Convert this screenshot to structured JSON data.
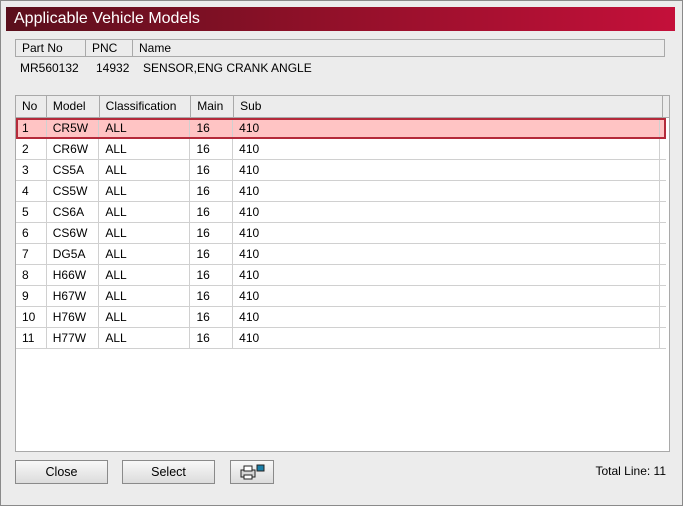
{
  "window": {
    "title": "Applicable Vehicle Models"
  },
  "part": {
    "headers": [
      "Part No",
      "PNC",
      "Name"
    ],
    "part_no": "MR560132",
    "pnc": "14932",
    "name": "SENSOR,ENG CRANK ANGLE"
  },
  "list": {
    "headers": [
      "No",
      "Model",
      "Classification",
      "Main",
      "Sub"
    ],
    "rows": [
      {
        "no": "1",
        "model": "CR5W",
        "classification": "ALL",
        "main": "16",
        "sub": "410"
      },
      {
        "no": "2",
        "model": "CR6W",
        "classification": "ALL",
        "main": "16",
        "sub": "410"
      },
      {
        "no": "3",
        "model": "CS5A",
        "classification": "ALL",
        "main": "16",
        "sub": "410"
      },
      {
        "no": "4",
        "model": "CS5W",
        "classification": "ALL",
        "main": "16",
        "sub": "410"
      },
      {
        "no": "5",
        "model": "CS6A",
        "classification": "ALL",
        "main": "16",
        "sub": "410"
      },
      {
        "no": "6",
        "model": "CS6W",
        "classification": "ALL",
        "main": "16",
        "sub": "410"
      },
      {
        "no": "7",
        "model": "DG5A",
        "classification": "ALL",
        "main": "16",
        "sub": "410"
      },
      {
        "no": "8",
        "model": "H66W",
        "classification": "ALL",
        "main": "16",
        "sub": "410"
      },
      {
        "no": "9",
        "model": "H67W",
        "classification": "ALL",
        "main": "16",
        "sub": "410"
      },
      {
        "no": "10",
        "model": "H76W",
        "classification": "ALL",
        "main": "16",
        "sub": "410"
      },
      {
        "no": "11",
        "model": "H77W",
        "classification": "ALL",
        "main": "16",
        "sub": "410"
      }
    ],
    "selected_row": "1"
  },
  "footer": {
    "close_label": "Close",
    "select_label": "Select",
    "print_icon": "printer-icon",
    "total_label": "Total Line: 11"
  },
  "colors": {
    "title_start": "#5a0f1c",
    "title_end": "#c4103a",
    "selected_bg": "#ffc4c4",
    "selected_border": "#b42a3a"
  }
}
